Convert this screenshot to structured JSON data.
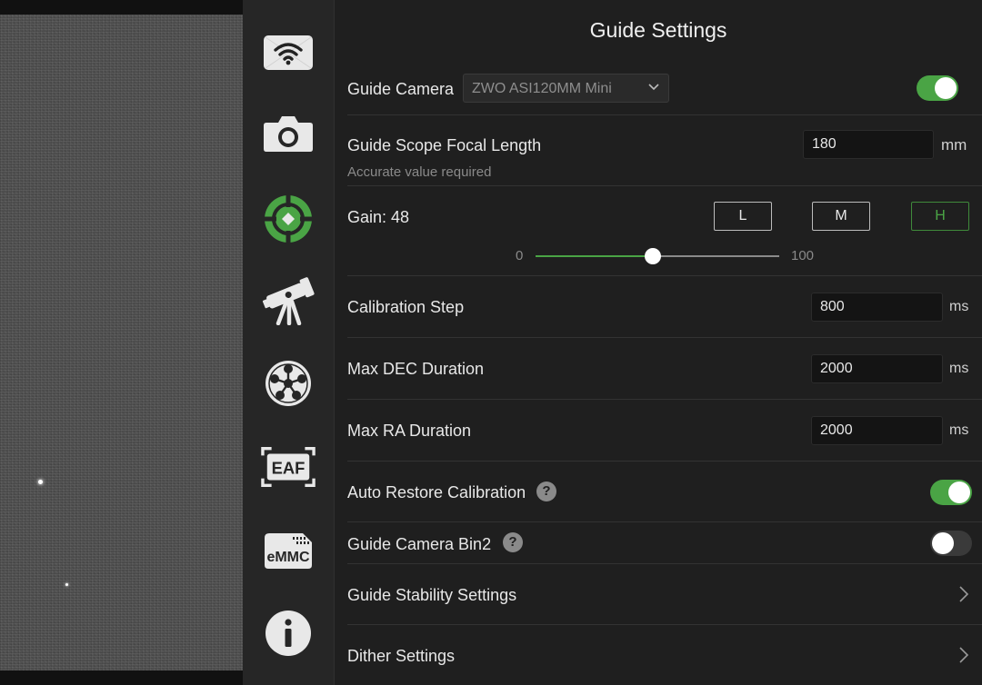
{
  "sidebar": {
    "items": [
      {
        "icon": "wifi-icon",
        "active": false
      },
      {
        "icon": "camera-icon",
        "active": false
      },
      {
        "icon": "guide-crosshair-icon",
        "active": true
      },
      {
        "icon": "telescope-icon",
        "active": false
      },
      {
        "icon": "filter-wheel-icon",
        "active": false
      },
      {
        "icon": "eaf-icon",
        "label": "EAF",
        "active": false
      },
      {
        "icon": "emmc-icon",
        "label": "eMMC",
        "active": false
      },
      {
        "icon": "info-icon",
        "active": false
      }
    ]
  },
  "panel": {
    "title": "Guide Settings",
    "guide_camera": {
      "label": "Guide Camera",
      "value": "ZWO ASI120MM Mini",
      "enabled": true
    },
    "focal_length": {
      "label": "Guide Scope Focal Length",
      "value": "180",
      "unit": "mm",
      "hint": "Accurate value required"
    },
    "gain": {
      "label": "Gain: 48",
      "value": 48,
      "min_label": "0",
      "max_label": "100",
      "min": 0,
      "max": 100,
      "presets": [
        {
          "label": "L",
          "active": false
        },
        {
          "label": "M",
          "active": false
        },
        {
          "label": "H",
          "active": true
        }
      ]
    },
    "calibration_step": {
      "label": "Calibration Step",
      "value": "800",
      "unit": "ms"
    },
    "max_dec": {
      "label": "Max DEC Duration",
      "value": "2000",
      "unit": "ms"
    },
    "max_ra": {
      "label": "Max RA Duration",
      "value": "2000",
      "unit": "ms"
    },
    "auto_restore": {
      "label": "Auto Restore Calibration",
      "help": "?",
      "enabled": true
    },
    "bin2": {
      "label": "Guide Camera Bin2",
      "help": "?",
      "enabled": false
    },
    "stability": {
      "label": "Guide Stability Settings"
    },
    "dither": {
      "label": "Dither Settings"
    }
  },
  "colors": {
    "accent": "#4aa445",
    "background": "#1f1f1f",
    "sidebar": "#262626"
  }
}
